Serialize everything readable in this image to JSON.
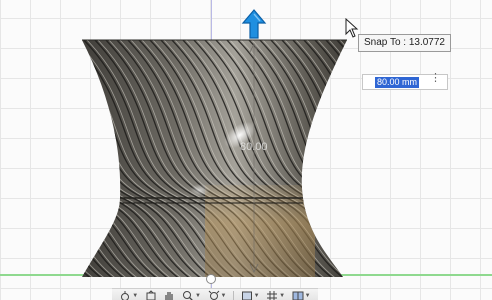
{
  "dimension": {
    "snap_tooltip": "Snap To : 13.0772",
    "input_value": "80.00 mm",
    "menu_glyph": "⋮",
    "model_dimension_label": "80.00"
  },
  "nav_toolbar": {
    "items": [
      {
        "icon": "orbit-icon"
      },
      {
        "icon": "look-at-icon"
      },
      {
        "icon": "pan-hand-icon"
      },
      {
        "icon": "zoom-icon"
      },
      {
        "icon": "fit-icon"
      },
      {
        "icon": "display-settings-icon"
      },
      {
        "icon": "grid-settings-icon"
      },
      {
        "icon": "viewports-icon"
      }
    ]
  },
  "colors": {
    "model_dark": "#3e3c38",
    "model_highlight": "#e9e7e1",
    "model_gold": "#a48a5e",
    "arrow_blue": "#1f8fe0",
    "ground_green": "#8fd98f",
    "selection_blue": "#2f66d4"
  }
}
